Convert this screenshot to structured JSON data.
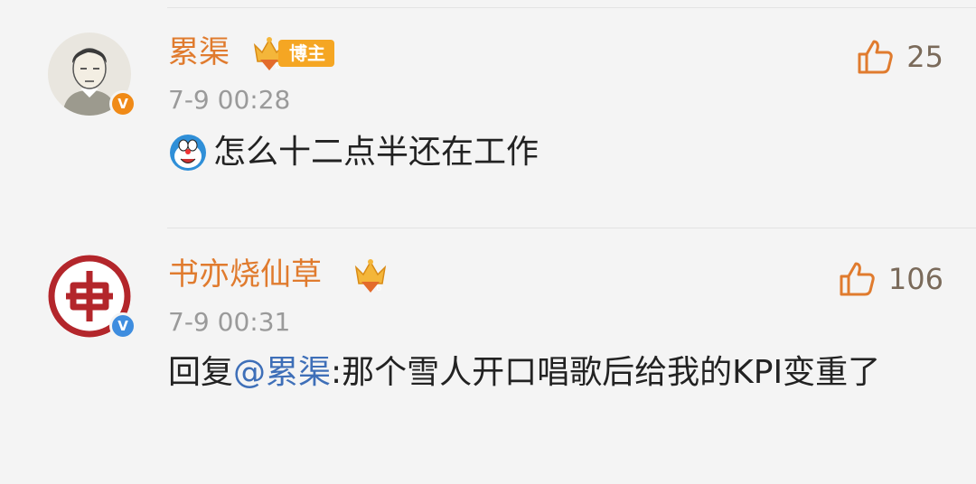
{
  "comments": [
    {
      "username": "累渠",
      "badge_label": "博主",
      "time": "7-9 00:28",
      "likes": "25",
      "content": "怎么十二点半还在工作",
      "colors": {
        "name": "#e07b2e",
        "verify_badge": "#f08a17"
      },
      "icons": [
        "doraemon-emoji-icon",
        "crown-level-icon",
        "thumb-up-icon",
        "verified-v-icon"
      ]
    },
    {
      "username": "书亦烧仙草",
      "time": "7-9 00:31",
      "likes": "106",
      "reply_prefix": "回复",
      "mention": "@累渠",
      "reply_text": ":那个雪人开口唱歌后给我的KPI变重了",
      "colors": {
        "name": "#e07b2e",
        "verify_badge": "#3e8ddf",
        "mention": "#3e6fb8"
      },
      "icons": [
        "brand-logo-icon",
        "crown-level-icon",
        "thumb-up-icon",
        "verified-v-icon"
      ]
    }
  ]
}
